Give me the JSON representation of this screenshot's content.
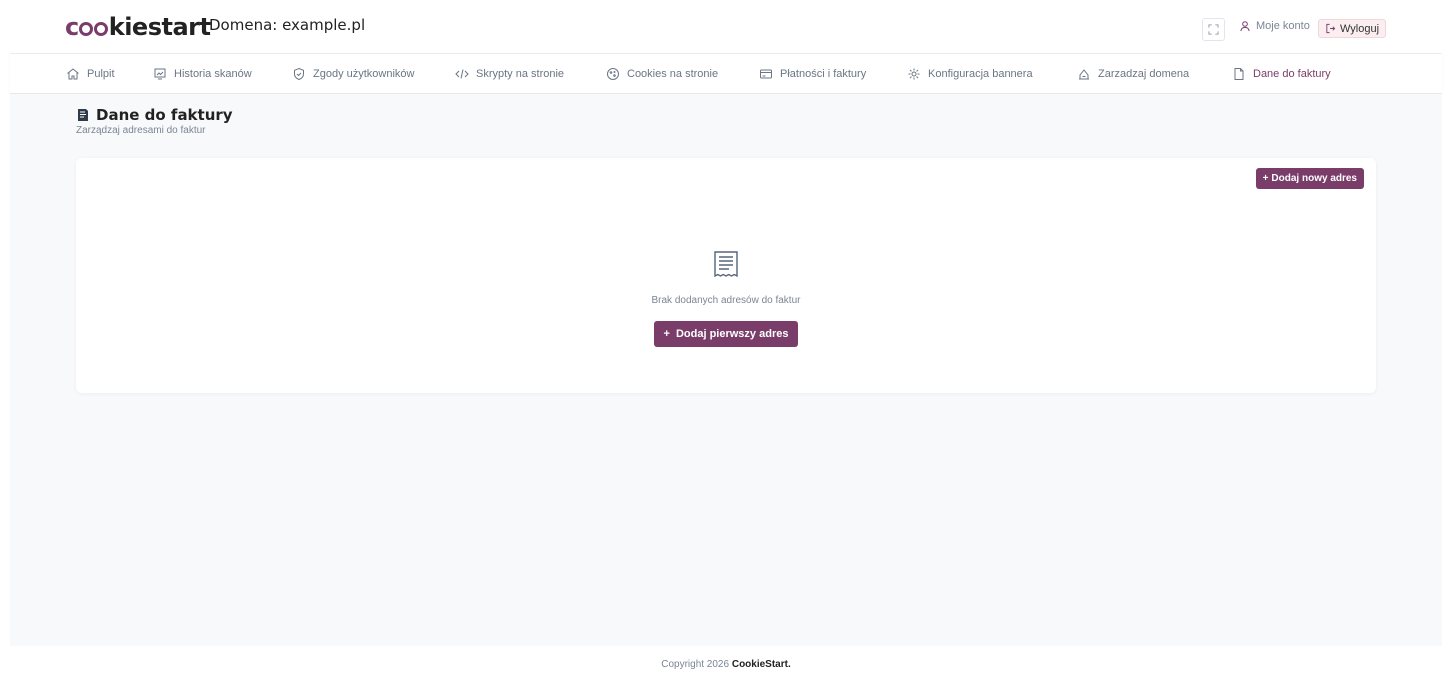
{
  "header": {
    "logo": {
      "part1": "c",
      "part2": "kiestart"
    },
    "domain_label": "Domena: example.pl",
    "account_label": "Moje konto",
    "logout_label": "Wyloguj"
  },
  "nav": {
    "items": [
      {
        "label": "Pulpit",
        "icon": "home-icon"
      },
      {
        "label": "Historia skanów",
        "icon": "scan-history-icon"
      },
      {
        "label": "Zgody użytkowników",
        "icon": "shield-check-icon"
      },
      {
        "label": "Skrypty na stronie",
        "icon": "code-icon"
      },
      {
        "label": "Cookies na stronie",
        "icon": "cookie-icon"
      },
      {
        "label": "Płatności i faktury",
        "icon": "credit-card-icon"
      },
      {
        "label": "Konfiguracja bannera",
        "icon": "gear-icon"
      },
      {
        "label": "Zarzadzaj domena",
        "icon": "manage-domain-icon"
      },
      {
        "label": "Dane do faktury",
        "icon": "document-icon",
        "active": true
      }
    ]
  },
  "page": {
    "title": "Dane do faktury",
    "subtitle": "Zarządzaj adresami do faktur"
  },
  "card": {
    "add_new_label": "Dodaj nowy adres",
    "empty_text": "Brak dodanych adresów do faktur",
    "add_first_label": "Dodaj pierwszy adres"
  },
  "footer": {
    "copyright": "Copyright 2026",
    "brand": "CookieStart."
  },
  "colors": {
    "accent": "#7a3d6a",
    "background": "#f8f9fb"
  }
}
